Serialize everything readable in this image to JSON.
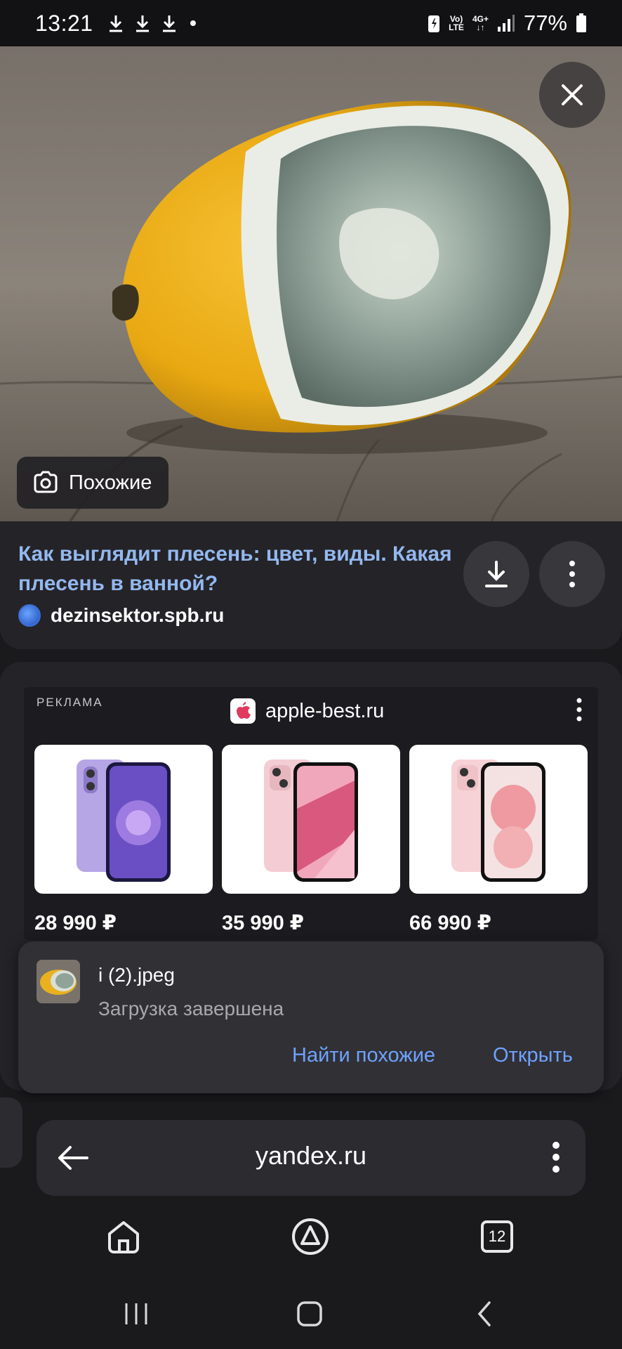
{
  "status_bar": {
    "time": "13:21",
    "lte_top": "Vo)",
    "lte_bottom": "LTE",
    "net_top": "4G+",
    "battery": "77%"
  },
  "image_viewer": {
    "similar_label": "Похожие",
    "close_icon": "close-icon"
  },
  "result": {
    "title": "Как выглядит плесень: цвет, виды. Какая плесень в ванной?",
    "source": "dezinsektor.spb.ru"
  },
  "ad": {
    "label": "РЕКЛАМА",
    "domain": "apple-best.ru",
    "products": [
      {
        "price": "28 990 ₽",
        "color": "#b7a6e6"
      },
      {
        "price": "35 990 ₽",
        "color": "#f4cdd4"
      },
      {
        "price": "66 990 ₽",
        "color": "#f6d2d6"
      }
    ]
  },
  "toast": {
    "filename": "i (2).jpeg",
    "status": "Загрузка завершена",
    "find_similar": "Найти похожие",
    "open": "Открыть"
  },
  "address_bar": {
    "url": "yandex.ru"
  },
  "toolbar": {
    "tabs_count": "12"
  },
  "colors": {
    "link": "#93b8ef",
    "action": "#6fa2ff",
    "card": "#242327"
  }
}
